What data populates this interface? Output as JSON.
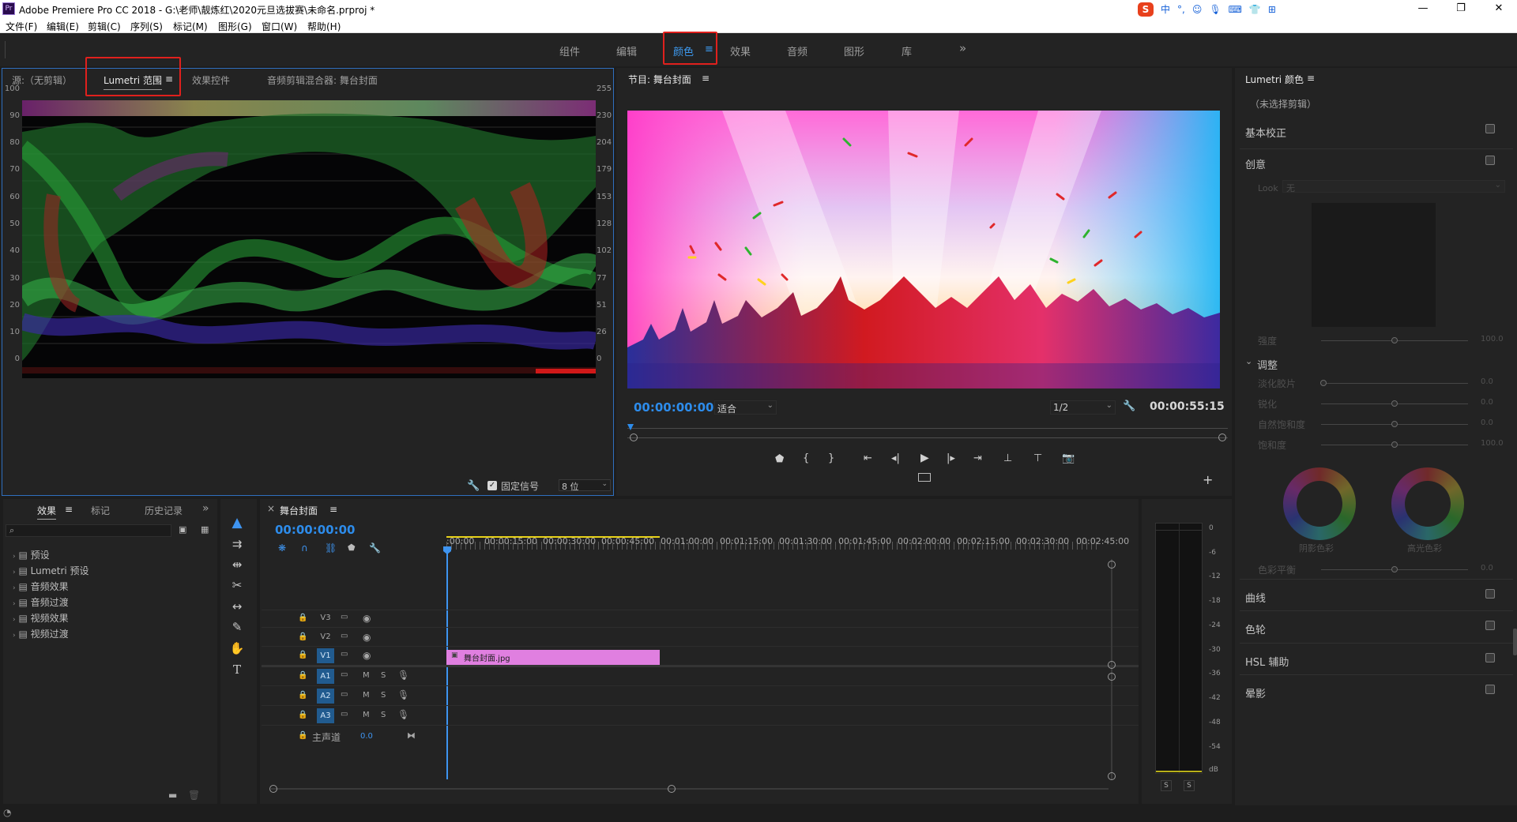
{
  "window": {
    "app_badge": "Pr",
    "title": "Adobe Premiere Pro CC 2018 - G:\\老师\\靓炼红\\2020元旦选拔赛\\未命名.prproj *",
    "ime": {
      "badge": "S",
      "items": [
        "中",
        "°,",
        "☺",
        "🎙",
        "⌨",
        "👕",
        "⊞"
      ]
    },
    "controls": {
      "minimize": "—",
      "maximize": "❐",
      "close": "✕"
    }
  },
  "menu": [
    "文件(F)",
    "编辑(E)",
    "剪辑(C)",
    "序列(S)",
    "标记(M)",
    "图形(G)",
    "窗口(W)",
    "帮助(H)"
  ],
  "workspaces": {
    "tabs": [
      "组件",
      "编辑",
      "颜色",
      "效果",
      "音频",
      "图形",
      "库"
    ],
    "active": "颜色",
    "active_menu": "≡",
    "more": "»"
  },
  "source_panel": {
    "tabs": [
      "源:（无剪辑）",
      "Lumetri 范围",
      "效果控件",
      "音频剪辑混合器: 舞台封面"
    ],
    "active_menu": "≡",
    "scale_left": [
      "100",
      "90",
      "80",
      "70",
      "60",
      "50",
      "40",
      "30",
      "20",
      "10",
      "0"
    ],
    "scale_right": [
      "255",
      "230",
      "204",
      "179",
      "153",
      "128",
      "102",
      "77",
      "51",
      "26",
      "0"
    ],
    "clamp_label": "固定信号",
    "clamp_checked": true,
    "bit_depth": "8 位"
  },
  "program_monitor": {
    "title": "节目: 舞台封面",
    "menu": "≡",
    "timecode_current": "00:00:00:00",
    "fit": "适合",
    "resolution": "1/2",
    "timecode_duration": "00:00:55:15",
    "add_button": "+"
  },
  "lumetri_color": {
    "title": "Lumetri 颜色",
    "menu": "≡",
    "clip": "（未选择剪辑）",
    "sections": [
      {
        "label": "基本校正",
        "checked": true
      },
      {
        "label": "创意",
        "checked": true
      },
      {
        "label": "曲线",
        "checked": true
      },
      {
        "label": "色轮",
        "checked": true
      },
      {
        "label": "HSL 辅助",
        "checked": true
      },
      {
        "label": "晕影",
        "checked": true
      }
    ],
    "look_label": "Look",
    "look_value": "无",
    "intensity_label": "强度",
    "intensity_value": "100.0",
    "adjust_label": "调整",
    "sliders": [
      {
        "label": "淡化胶片",
        "value": "0.0",
        "level": 0
      },
      {
        "label": "锐化",
        "value": "0.0",
        "level": 0.5
      },
      {
        "label": "自然饱和度",
        "value": "0.0",
        "level": 0.5
      },
      {
        "label": "饱和度",
        "value": "100.0",
        "level": 0.5
      }
    ],
    "shadow_tint": "阴影色彩",
    "highlight_tint": "高光色彩",
    "color_balance_label": "色彩平衡",
    "color_balance_value": "0.0"
  },
  "effects_panel": {
    "tabs": [
      "效果",
      "标记",
      "历史记录"
    ],
    "menu": "≡",
    "more": "»",
    "search_placeholder": "",
    "items": [
      "预设",
      "Lumetri 预设",
      "音频效果",
      "音频过渡",
      "视频效果",
      "视频过渡"
    ]
  },
  "timeline": {
    "title": "舞台封面",
    "menu": "≡",
    "close": "×",
    "timecode": "00:00:00:00",
    "ruler": [
      ":00:00",
      "00:00:15:00",
      "00:00:30:00",
      "00:00:45:00",
      "00:01:00:00",
      "00:01:15:00",
      "00:01:30:00",
      "00:01:45:00",
      "00:02:00:00",
      "00:02:15:00",
      "00:02:30:00",
      "00:02:45:00"
    ],
    "video_tracks": [
      "V3",
      "V2",
      "V1"
    ],
    "audio_tracks": [
      "A1",
      "A2",
      "A3"
    ],
    "audio_btn_m": "M",
    "audio_btn_s": "S",
    "master_label": "主声道",
    "master_value": "0.0",
    "clip_name": "舞台封面.jpg",
    "clip_color": "#e07fe0"
  },
  "audio_meter": {
    "scale": [
      "0",
      "-6",
      "-12",
      "-18",
      "-24",
      "-30",
      "-36",
      "-42",
      "-48",
      "-54",
      "dB"
    ],
    "solo": [
      "S",
      "S"
    ]
  },
  "colors": {
    "accent": "#2d8ceb",
    "highlight_box": "#e0201d",
    "panel": "#232323"
  }
}
